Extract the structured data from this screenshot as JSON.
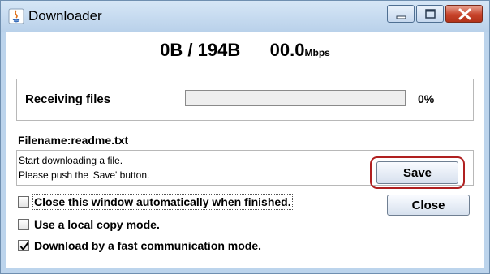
{
  "window": {
    "title": "Downloader",
    "icons": {
      "app": "java-app-icon",
      "minimize": "minimize-icon",
      "maximize": "maximize-icon",
      "close": "close-icon"
    }
  },
  "transfer": {
    "size_text": "0B / 194B",
    "speed_value": "00.0",
    "speed_unit": "Mbps"
  },
  "progress": {
    "label": "Receiving files",
    "percent_text": "0%",
    "value": 0
  },
  "file": {
    "filename_text": "Filename:readme.txt",
    "messages": [
      "Start downloading a file.",
      "Please push the 'Save' button."
    ]
  },
  "options": [
    {
      "label": "Close this window automatically when finished.",
      "checked": false,
      "focused": true
    },
    {
      "label": "Use a local copy mode.",
      "checked": false
    },
    {
      "label": "Download by a fast communication mode.",
      "checked": true
    }
  ],
  "buttons": {
    "save": "Save",
    "close": "Close"
  },
  "colors": {
    "highlight_ring": "#b02020",
    "titlebar": "#c6dbf1",
    "close_caption": "#c7432a"
  }
}
